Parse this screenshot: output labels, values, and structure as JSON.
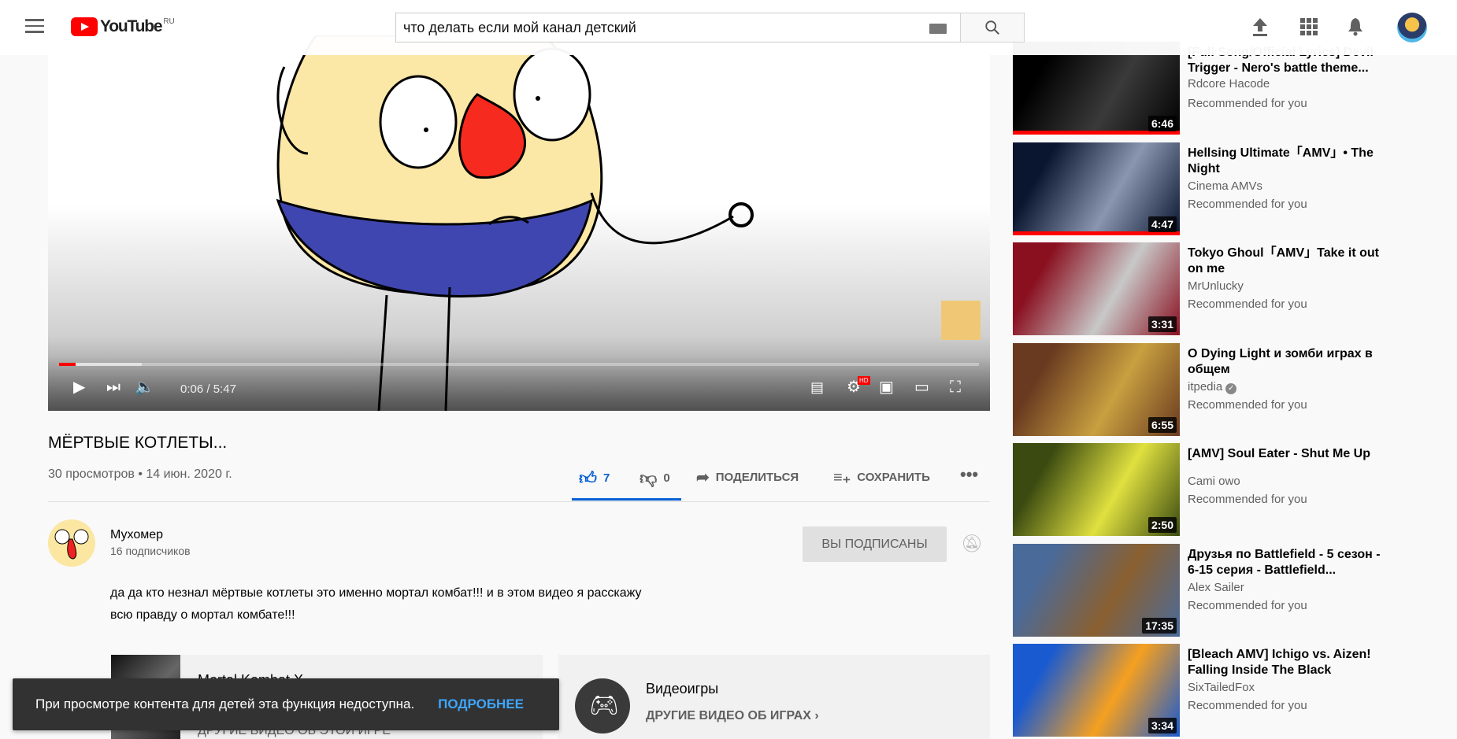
{
  "header": {
    "logo": "YouTube",
    "region": "RU",
    "search_value": "что делать если мой канал детский"
  },
  "player": {
    "time_current": "0:06",
    "time_total": "5:47",
    "progress_fraction": 0.018,
    "buffered_fraction": 0.09,
    "hd_badge": "HD"
  },
  "video": {
    "title": "МЁРТВЫЕ КОТЛЕТЫ...",
    "meta": "30 просмотров • 14 июн. 2020 г.",
    "likes": "7",
    "dislikes": "0",
    "share": "ПОДЕЛИТЬСЯ",
    "save": "СОХРАНИТЬ"
  },
  "channel": {
    "name": "Мухомер",
    "subscribers": "16 подписчиков",
    "subscribe_label": "ВЫ ПОДПИСАНЫ"
  },
  "description": [
    "да да кто незнал мёртвые котлеты это именно мортал комбат!!! и в этом видео я расскажу",
    "всю правду о мортал комбате!!!"
  ],
  "cards": {
    "game": "Mortal Kombat X",
    "game_sub": "ДРУГИЕ ВИДЕО ОБ ЭТОЙ ИГРЕ",
    "category": "Видеоигры",
    "category_link": "ДРУГИЕ ВИДЕО ОБ ИГРАХ"
  },
  "toast": {
    "message": "При просмотре контента для детей эта функция недоступна.",
    "action": "ПОДРОБНЕЕ"
  },
  "recommendations": [
    {
      "title": "[Full Song/Official Lyrics] Devil Trigger - Nero's battle theme...",
      "channel": "Rdcore Hacode",
      "note": "Recommended for you",
      "duration": "6:46",
      "watched": true,
      "colors": [
        "#000",
        "#3a3a3a"
      ]
    },
    {
      "title": "Hellsing Ultimate「AMV」• The Night",
      "channel": "Cinema AMVs",
      "note": "Recommended for you",
      "duration": "4:47",
      "watched": true,
      "colors": [
        "#0a1530",
        "#8a96b0"
      ]
    },
    {
      "title": "Tokyo Ghoul「AMV」Take it out on me",
      "channel": "MrUnlucky",
      "note": "Recommended for you",
      "duration": "3:31",
      "watched": false,
      "colors": [
        "#8a1020",
        "#c8c8c8"
      ]
    },
    {
      "title": "O Dying Light и зомби играх в общем",
      "channel": "itpedia",
      "verified": true,
      "note": "Recommended for you",
      "duration": "6:55",
      "watched": false,
      "colors": [
        "#6a3a20",
        "#c8a040"
      ]
    },
    {
      "title": "[AMV] Soul Eater - Shut Me Up",
      "channel": "Cami owo",
      "note": "Recommended for you",
      "duration": "2:50",
      "watched": false,
      "colors": [
        "#3a4a10",
        "#e0e040"
      ]
    },
    {
      "title": "Друзья по Battlefield - 5 сезон - 6-15 серия - Battlefield...",
      "channel": "Alex Sailer",
      "note": "Recommended for you",
      "duration": "17:35",
      "watched": false,
      "colors": [
        "#4a6a9a",
        "#8a6030"
      ]
    },
    {
      "title": "[Bleach AMV] Ichigo vs. Aizen! Falling Inside The Black",
      "channel": "SixTailedFox",
      "note": "Recommended for you",
      "duration": "3:34",
      "watched": false,
      "colors": [
        "#1a5ad0",
        "#f5a020"
      ]
    }
  ]
}
